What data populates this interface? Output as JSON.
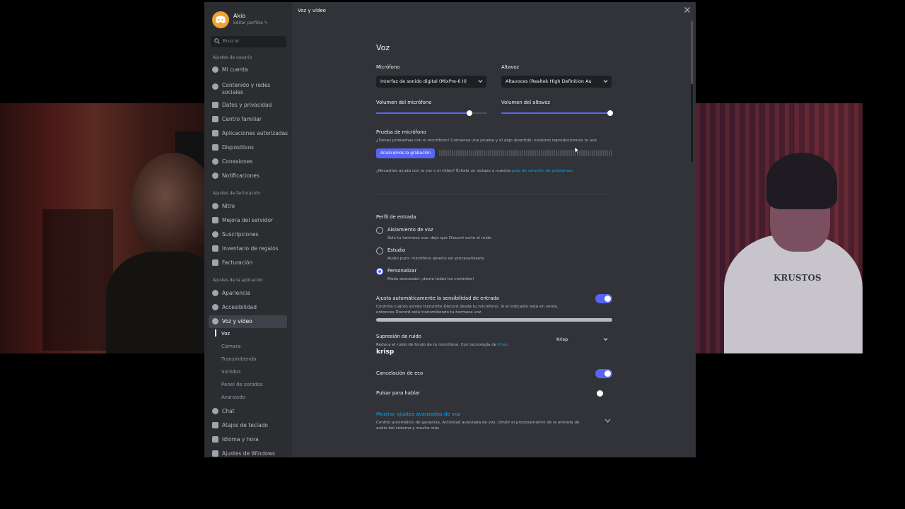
{
  "window": {
    "title": "Voz y vídeo"
  },
  "profile": {
    "name": "Akio",
    "edit_label": "Editar perfiles ✎"
  },
  "search": {
    "placeholder": "Buscar"
  },
  "sidebar": {
    "user_header": "Ajustes de usuario",
    "user_items": [
      {
        "label": "Mi cuenta"
      },
      {
        "label": "Contenido y redes sociales"
      },
      {
        "label": "Datos y privacidad"
      },
      {
        "label": "Centro familiar"
      },
      {
        "label": "Aplicaciones autorizadas"
      },
      {
        "label": "Dispositivos"
      },
      {
        "label": "Conexiones"
      },
      {
        "label": "Notificaciones"
      }
    ],
    "billing_header": "Ajustes de facturación",
    "billing_items": [
      {
        "label": "Nitro"
      },
      {
        "label": "Mejora del servidor"
      },
      {
        "label": "Suscripciones"
      },
      {
        "label": "Inventario de regalos"
      },
      {
        "label": "Facturación"
      }
    ],
    "app_header": "Ajustes de la aplicación",
    "app_items": [
      {
        "label": "Apariencia"
      },
      {
        "label": "Accesibilidad"
      },
      {
        "label": "Voz y vídeo"
      }
    ],
    "voice_sub": [
      {
        "label": "Voz"
      },
      {
        "label": "Cámara"
      },
      {
        "label": "Transmitiendo"
      },
      {
        "label": "Sonidos"
      },
      {
        "label": "Panel de sonidos"
      },
      {
        "label": "Avanzado"
      }
    ],
    "more_items": [
      {
        "label": "Chat"
      },
      {
        "label": "Atajos de teclado"
      },
      {
        "label": "Idioma y hora"
      },
      {
        "label": "Ajustes de Windows"
      }
    ]
  },
  "voice": {
    "heading": "Voz",
    "mic_label": "Micrófono",
    "mic_value": "Interfaz de sonido digital (MixPre-6 II)",
    "speaker_label": "Altavoz",
    "speaker_value": "Altavoces (Realtek High Definition Au",
    "mic_volume_label": "Volumen del micrófono",
    "mic_volume": 0.84,
    "speaker_volume_label": "Volumen del altavoz",
    "speaker_volume": 1.0,
    "mic_test_label": "Prueba de micrófono",
    "mic_test_desc": "¿Tienes problemas con el micrófono? Comienza una prueba y di algo divertido; nosotros reproduciremos tu voz.",
    "mic_test_button": "Analicemos la grabación",
    "help_text": "¿Necesitas ayuda con la voz o el vídeo? Échale un vistazo a nuestra",
    "help_link": "guía de solución de problemas."
  },
  "input_profile": {
    "label": "Perfil de entrada",
    "options": [
      {
        "label": "Aislamiento de voz",
        "desc": "Solo tu hermosa voz: deja que Discord corte el ruido",
        "selected": false
      },
      {
        "label": "Estudio",
        "desc": "Audio puro: micrófono abierto sin procesamiento",
        "selected": false
      },
      {
        "label": "Personalizar",
        "desc": "Modo avanzado: ¡dame todos los controles!",
        "selected": true
      }
    ]
  },
  "sensitivity": {
    "label": "Ajusta automáticamente la sensibilidad de entrada",
    "desc1": "Controla cuánto sonido transmite Discord desde tu micrófono. Si el indicador está en verde,",
    "desc2": "entonces Discord está transmitiendo tu hermosa voz.",
    "enabled": true
  },
  "noise": {
    "label": "Supresión de ruido",
    "desc_prefix": "Reduce el ruido de fondo de tu micrófono. Con tecnología de",
    "desc_link": "Krisp.",
    "logo": "krisp",
    "value": "Krisp"
  },
  "echo": {
    "label": "Cancelación de eco",
    "enabled": true
  },
  "ptt": {
    "label": "Pulsar para hablar",
    "enabled": false
  },
  "advanced": {
    "link": "Mostrar ajustes avanzados de voz",
    "desc1": "Control automático de ganancia, Actividad avanzada de voz, Omitir el procesamiento de la entrada de",
    "desc2": "audio del sistema y mucho más"
  },
  "colors": {
    "accent": "#5865f2",
    "link": "#00a8fc",
    "avatar": "#f0a232"
  },
  "webcam_overlay_text": "KRUSTOS"
}
